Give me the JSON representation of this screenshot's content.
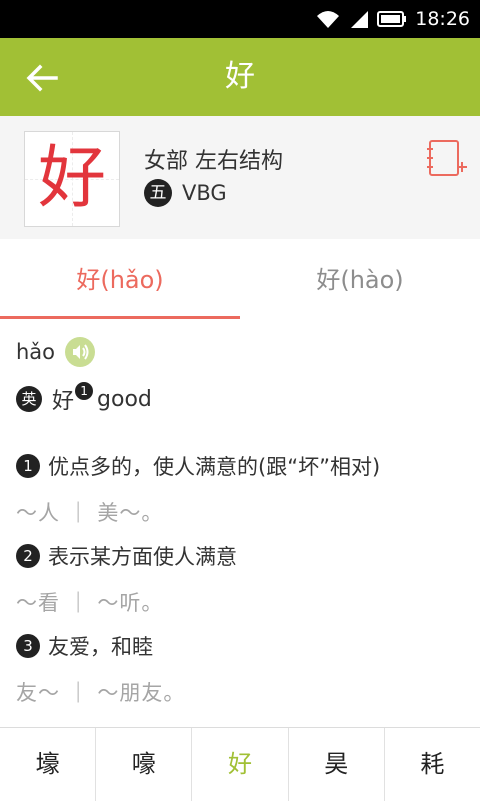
{
  "status_bar": {
    "time": "18:26"
  },
  "appbar": {
    "title": "好"
  },
  "header": {
    "character": "好",
    "radical_structure": "女部  左右结构",
    "wubi_badge": "五",
    "wubi_code": "VBG"
  },
  "tabs": [
    {
      "label": "好(hǎo)",
      "active": true
    },
    {
      "label": "好(hào)",
      "active": false
    }
  ],
  "entry": {
    "pinyin": "hǎo",
    "english_badge": "英",
    "english_char": "好",
    "english_sup": "1",
    "english_word": "good",
    "definitions": [
      {
        "num": "1",
        "text": "优点多的，使人满意的(跟“坏”相对)",
        "example": "～人  ｜ 美～。"
      },
      {
        "num": "2",
        "text": "表示某方面使人满意",
        "example": "～看  ｜ ～听。"
      },
      {
        "num": "3",
        "text": "友爱，和睦",
        "example": "友～  ｜ ～朋友。"
      }
    ]
  },
  "bottom_nav": [
    {
      "label": "壕",
      "current": false
    },
    {
      "label": "嚎",
      "current": false
    },
    {
      "label": "好",
      "current": true
    },
    {
      "label": "昊",
      "current": false
    },
    {
      "label": "耗",
      "current": false
    }
  ],
  "colors": {
    "accent_green": "#a1c035",
    "accent_red": "#ec6a5e",
    "char_red": "#e2353c"
  }
}
